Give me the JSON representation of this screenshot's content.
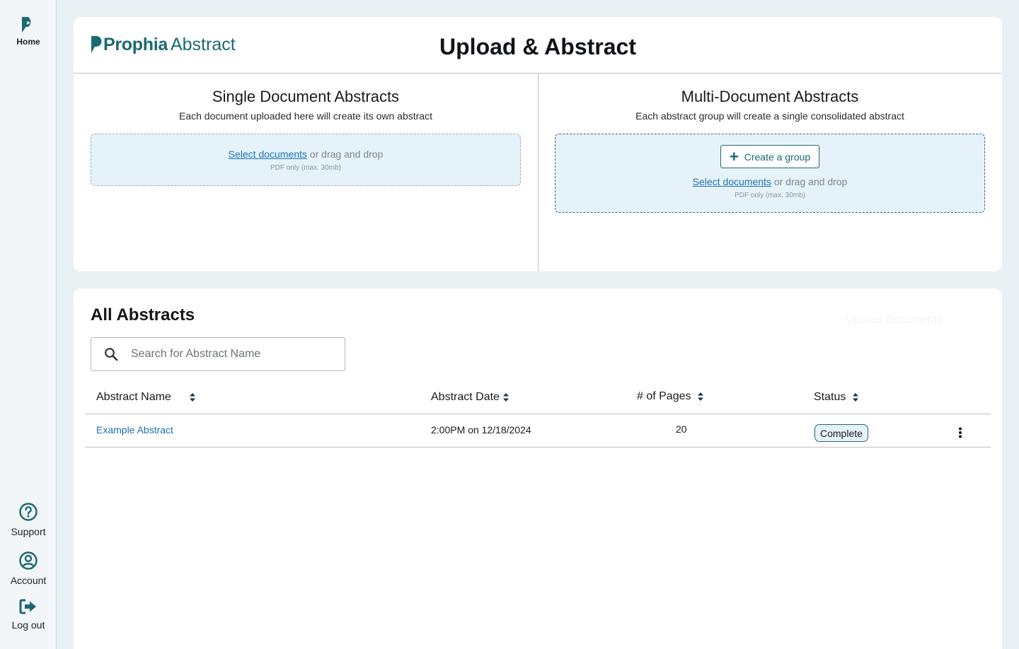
{
  "sidebar": {
    "home_label": "Home",
    "support_label": "Support",
    "account_label": "Account",
    "logout_label": "Log out",
    "accent_color": "#1b6a70"
  },
  "header": {
    "brand_bold": "Prophia",
    "brand_light": "Abstract",
    "title": "Upload & Abstract"
  },
  "single": {
    "title": "Single Document Abstracts",
    "subtitle": "Each document uploaded here will create its own abstract",
    "select_link": "Select documents",
    "drag_text": " or drag and drop",
    "hint": "PDF only (max. 30mb)"
  },
  "multi": {
    "title": "Multi-Document Abstracts",
    "subtitle": "Each abstract group will create a single consolidated abstract",
    "create_group_label": "Create a group",
    "select_link": "Select documents",
    "drag_text": " or drag and drop",
    "hint": "PDF only (max. 30mb)"
  },
  "list": {
    "title": "All Abstracts",
    "ghost_label": "Upload Documents",
    "search_placeholder": "Search for Abstract Name",
    "columns": [
      "Abstract Name",
      "Abstract Date",
      "# of Pages",
      "Status"
    ],
    "rows": [
      {
        "name": "Example Abstract",
        "date": "2:00PM on 12/18/2024",
        "pages": "20",
        "status": "Complete"
      }
    ]
  }
}
